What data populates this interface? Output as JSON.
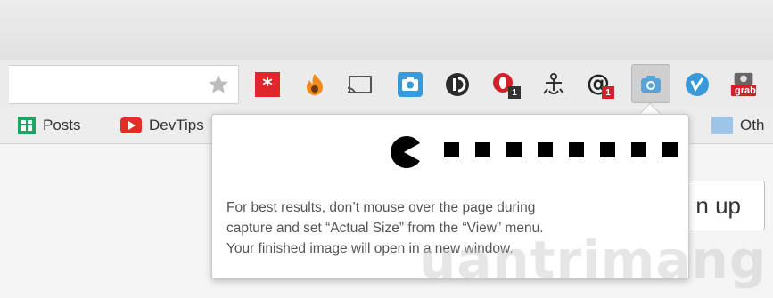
{
  "bookmarks": [
    {
      "label": "Posts",
      "icon": "sheets-icon"
    },
    {
      "label": "DevTips",
      "icon": "youtube-icon"
    },
    {
      "label": "Oth",
      "icon": "folder-icon"
    }
  ],
  "extensions": [
    {
      "name": "lastpass-icon"
    },
    {
      "name": "fire-icon"
    },
    {
      "name": "cast-icon"
    },
    {
      "name": "camera-icon"
    },
    {
      "name": "camera-icon-2"
    },
    {
      "name": "disconnect-icon"
    },
    {
      "name": "opera-icon",
      "badge": "1"
    },
    {
      "name": "bug-icon"
    },
    {
      "name": "at-mail-icon",
      "badge": "1"
    },
    {
      "name": "capture-camera-icon"
    },
    {
      "name": "vimeo-icon"
    },
    {
      "name": "grab-icon",
      "text": "grab"
    }
  ],
  "page": {
    "signup_label": "n up"
  },
  "popup": {
    "message_lines": [
      "For best results, don’t mouse over the page during",
      "capture and set “Actual Size” from the “View” menu.",
      "Your finished image will open in a new window."
    ],
    "progress_dots": 8
  },
  "watermark": "uantrimang",
  "colors": {
    "accent_red": "#e0262a",
    "accent_blue": "#3a9ad9",
    "youtube_red": "#e52d27",
    "sheets_green": "#1fa463"
  }
}
